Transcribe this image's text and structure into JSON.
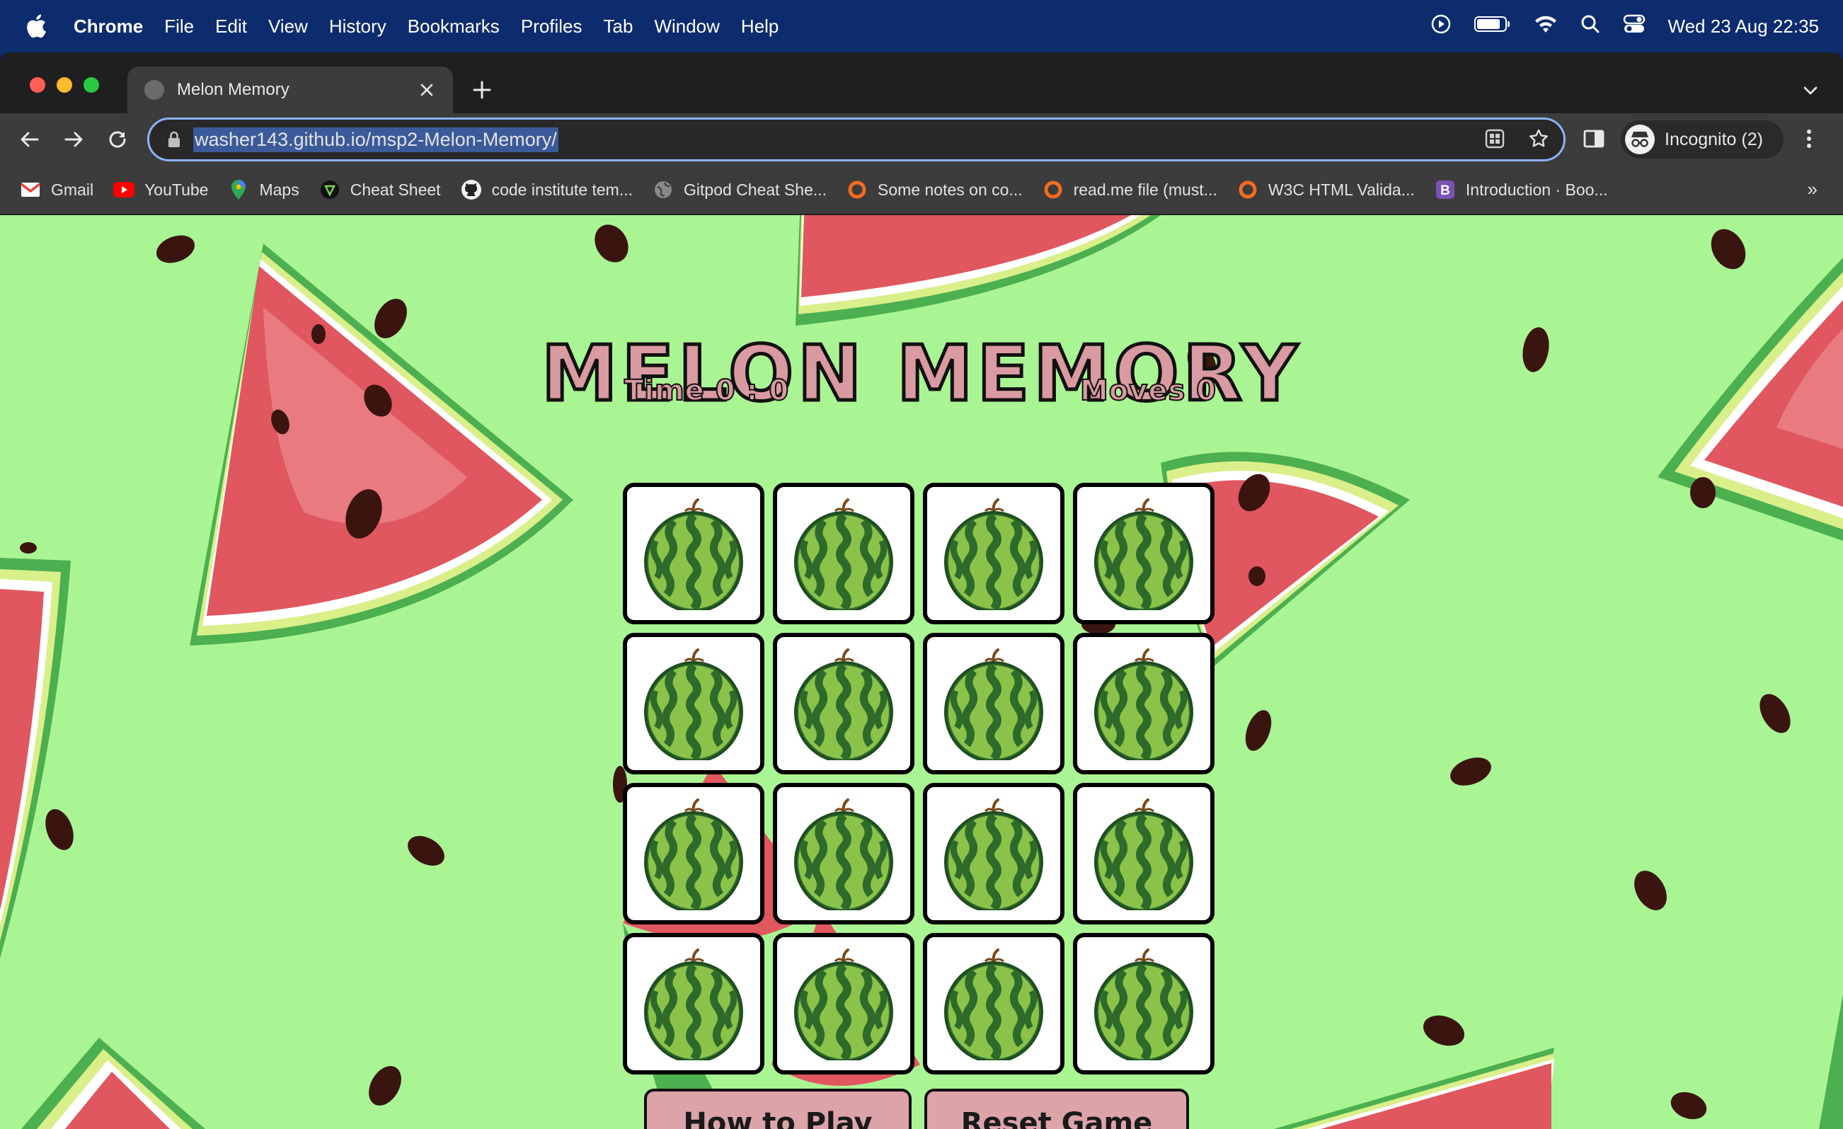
{
  "menubar": {
    "app": "Chrome",
    "items": [
      "File",
      "Edit",
      "View",
      "History",
      "Bookmarks",
      "Profiles",
      "Tab",
      "Window",
      "Help"
    ],
    "clock": "Wed 23 Aug  22:35"
  },
  "browser": {
    "tab_title": "Melon Memory",
    "url": "washer143.github.io/msp2-Melon-Memory/",
    "profile_label": "Incognito (2)",
    "bookmarks": [
      {
        "label": "Gmail",
        "icon": "gmail-icon"
      },
      {
        "label": "YouTube",
        "icon": "youtube-icon"
      },
      {
        "label": "Maps",
        "icon": "maps-icon"
      },
      {
        "label": "Cheat Sheet",
        "icon": "cheatsheet-icon"
      },
      {
        "label": "code institute tem...",
        "icon": "github-icon"
      },
      {
        "label": "Gitpod Cheat She...",
        "icon": "globe-icon"
      },
      {
        "label": "Some notes on co...",
        "icon": "circle-icon"
      },
      {
        "label": "read.me file (must...",
        "icon": "circle-icon"
      },
      {
        "label": "W3C HTML Valida...",
        "icon": "circle-icon"
      },
      {
        "label": "Introduction · Boo...",
        "icon": "bootstrap-icon"
      }
    ]
  },
  "game": {
    "title": "MELON MEMORY",
    "time_label": "Time 0 : 0",
    "moves_label": "Moves 0",
    "card_count": 16,
    "buttons": {
      "how_to_play": "How to Play",
      "reset": "Reset Game"
    }
  },
  "colors": {
    "page_bg": "#aaf593",
    "title_fill": "#d99aa1",
    "button_fill": "#dca3a8",
    "melon_red": "#e0575f",
    "melon_rind": "#4caf50"
  }
}
